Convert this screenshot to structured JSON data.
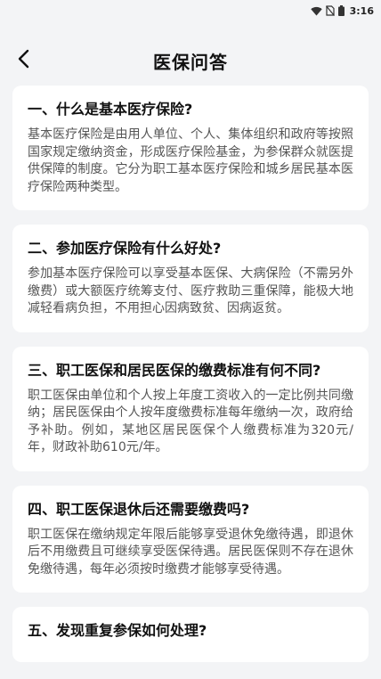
{
  "status_bar": {
    "time": "3:16",
    "icons": [
      "wifi-icon",
      "no-sim-icon",
      "battery-icon"
    ]
  },
  "header": {
    "title": "医保问答",
    "back_icon": "chevron-left-icon"
  },
  "faq": [
    {
      "title": "一、什么是基本医疗保险?",
      "body": "基本医疗保险是由用人单位、个人、集体组织和政府等按照国家规定缴纳资金，形成医疗保险基金，为参保群众就医提供保障的制度。它分为职工基本医疗保险和城乡居民基本医疗保险两种类型。"
    },
    {
      "title": "二、参加医疗保险有什么好处?",
      "body": "参加基本医疗保险可以享受基本医保、大病保险（不需另外缴费）或大额医疗统筹支付、医疗救助三重保障，能极大地减轻看病负担，不用担心因病致贫、因病返贫。"
    },
    {
      "title": "三、职工医保和居民医保的缴费标准有何不同?",
      "body": "职工医保由单位和个人按上年度工资收入的一定比例共同缴纳；居民医保由个人按年度缴费标准每年缴纳一次，政府给予补助。例如，某地区居民医保个人缴费标准为320元/年，财政补助610元/年。"
    },
    {
      "title": "四、职工医保退休后还需要缴费吗?",
      "body": "职工医保在缴纳规定年限后能够享受退休免缴待遇，即退休后不用缴费且可继续享受医保待遇。居民医保则不存在退休免缴待遇，每年必须按时缴费才能够享受待遇。"
    },
    {
      "title": "五、发现重复参保如何处理?",
      "body": ""
    }
  ]
}
